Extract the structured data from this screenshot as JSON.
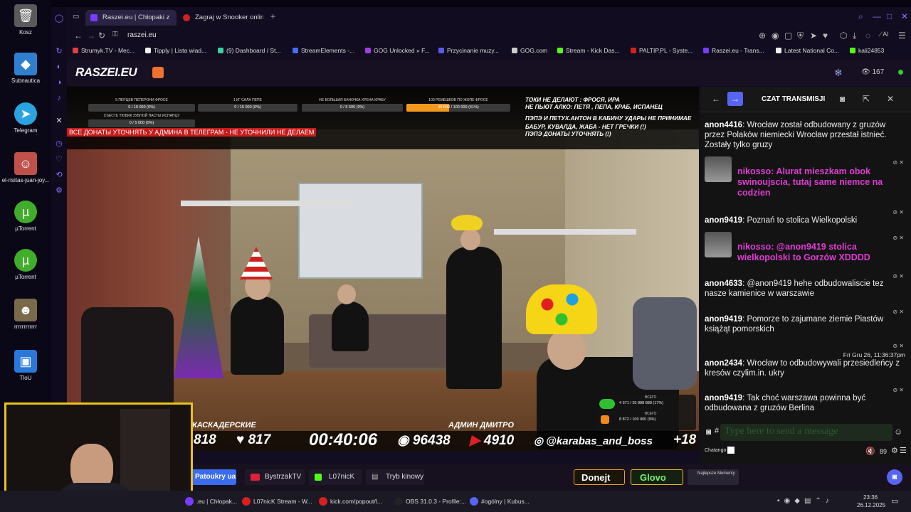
{
  "desktop": {
    "icons": [
      {
        "label": "Kosz",
        "icon": "trash-icon",
        "color": "#8a8a8a"
      },
      {
        "label": "Subnautica",
        "icon": "subnautica-icon",
        "color": "#2f7fd0"
      },
      {
        "label": "Telegram",
        "icon": "telegram-icon",
        "color": "#2aa3e0"
      },
      {
        "label": "el-risitas-juan-joy...",
        "icon": "image-file-icon",
        "color": "#c0504a"
      },
      {
        "label": "µTorrent",
        "icon": "utorrent-icon",
        "color": "#3fae2a"
      },
      {
        "label": "µTorrent",
        "icon": "utorrent-icon",
        "color": "#3fae2a"
      },
      {
        "label": "rrrrrrrrrrrr",
        "icon": "image-file-icon",
        "color": "#7a6a4a"
      },
      {
        "label": "TloU",
        "icon": "shortcut-icon",
        "color": "#2a78d8"
      }
    ]
  },
  "browser": {
    "tabs": [
      {
        "label": "Raszei.eu | Chłopaki z",
        "active": true,
        "favicon_color": "#7a3cff"
      },
      {
        "label": "Zagraj w Snooker online za",
        "active": false,
        "favicon_color": "#d02020"
      }
    ],
    "url": "raszei.eu",
    "bookmarks": [
      {
        "label": "Strumyk.TV - Mec...",
        "color": "#e04040"
      },
      {
        "label": "Tipply | Lista wiad...",
        "color": "#f0f0f0"
      },
      {
        "label": "(9) Dashboard / St...",
        "color": "#3ad0a0"
      },
      {
        "label": "StreamElements -...",
        "color": "#4a6cf0"
      },
      {
        "label": "GOG Unlocked » F...",
        "color": "#a040e0"
      },
      {
        "label": "Przycinanie muzy...",
        "color": "#5a5af0"
      },
      {
        "label": "GOG.com",
        "color": "#cccccc"
      },
      {
        "label": "Stream - Kick Das...",
        "color": "#53fc18"
      },
      {
        "label": "PALTIP.PL - Syste...",
        "color": "#d82020"
      },
      {
        "label": "Raszei.eu - Trans...",
        "color": "#7a3cff"
      },
      {
        "label": "Latest National Co...",
        "color": "#f0f0f0"
      },
      {
        "label": "kali24853",
        "color": "#53fc18"
      }
    ]
  },
  "site": {
    "logo": "RASZEI.EU",
    "viewers": "167",
    "overlay": {
      "goals": [
        {
          "label": "5 ПЕРЦЕВ ПЕПЕРОНИ ФРОСЕ",
          "value": "0 / 10 000 (0%)"
        },
        {
          "label": "1 КГ САЛА ПЕПЕ",
          "value": "0 / 15 000 (0%)"
        },
        {
          "label": "НЕ БОЛЬШАЯ БАНОЧКА ХРЕНА КРАБУ",
          "value": "0 / 5 500 (0%)"
        },
        {
          "label": "100 РЕМЕШКОВ ПО ЖОПЕ ФРОСЕ",
          "value": "40 600 / 100 000 (41%)",
          "progress": 0.41
        },
        {
          "label": "СЪЕСТЬ ТЮБИК ЗУБНОЙ ПАСТЫ ИСПАНЦУ",
          "value": "0 / 5 000 (0%)"
        }
      ],
      "right_text_1": "ТОКИ НЕ ДЕЛАЮТ : ФРОСЯ, ИРА",
      "right_text_2": "НЕ ПЬЮТ АЛКО: ПЕТЯ , ПЕПА, КРАБ, ИСПАНЕЦ",
      "right_text_3": "ПЭПЭ И ПЕТУХ.АНТОН В КАБИНУ УДАРЫ НЕ ПРИНИМАЕ",
      "right_text_4": "БАБУР, КУВАЛДА, ЖАБА - НЕТ ГРЕЧКИ (!)",
      "right_text_5": "ПЭПЭ ДОНАТЫ УТОЧНЯТЬ (!)",
      "red_note": "ВСЕ ДОНАТЫ УТОЧНЯТЬ У АДМИНА В ТЕЛЕГРАМ - НЕ УТОЧНИЛИ НЕ ДЕЛАЕМ",
      "name_left": "КАСКАДЕРСКИЕ",
      "name_right": "АДМИН ДМИТРО",
      "stats": {
        "left_num": "818",
        "likes": "817",
        "timer": "00:40:06",
        "views": "96438",
        "youtube": "4910",
        "instagram": "@karabas_and_boss",
        "plus": "+18"
      },
      "total_1_label": "ВСЕГО",
      "total_1": "4 371 / 25 888 888 (17%)",
      "total_2_label": "ВСЕГО",
      "total_2": "8 872 / 100 000 (9%)"
    },
    "chat": {
      "title": "CZAT TRANSMISJI",
      "messages": [
        {
          "user": "anon4416",
          "text": "Wrocław został odbudowany z gruzów przez Polaków niemiecki Wrocław przestał istnieć. Zostały tylko gruzy",
          "pink": false
        },
        {
          "user": "nikosso",
          "text": "Alurat mieszkam obok swinoujscia, tutaj same niemce na codzien",
          "pink": true
        },
        {
          "user": "anon9419",
          "text": "Poznań to stolica Wielkopolski",
          "pink": false
        },
        {
          "user": "nikosso",
          "text": "@anon9419 stolica wielkopolski to Gorzów XDDDD",
          "pink": true
        },
        {
          "user": "anon4633",
          "text": "@anon9419 hehe odbudowaliscie tez nasze kamienice w warszawie",
          "pink": false
        },
        {
          "user": "anon9419",
          "text": "Pomorze to zajumane ziemie Piastów książąt pomorskich",
          "pink": false
        },
        {
          "user": "anon2434",
          "text": "Wrocław to odbudowywali przesiedleńcy z kresów czylim.in. ukry",
          "pink": false,
          "timestamp": "Fri Gru 26, 11:36:37pm"
        },
        {
          "user": "anon9419",
          "text": "Tak choć warszawa powinna być odbudowana z gruzów Berlina",
          "pink": false
        }
      ],
      "input_placeholder": "Type here to send a message",
      "footer_label": "Chatango",
      "volume": "89"
    },
    "footer_buttons": [
      {
        "label": "Patoukry ua",
        "color": "#3a6cf0"
      },
      {
        "label": "BystrzakTV",
        "color": "#e0203a"
      },
      {
        "label": "L07nicK",
        "color": "#53fc18"
      },
      {
        "label": "Tryb kinowy",
        "color": "#bbbbbb"
      }
    ],
    "donate": "Donejt",
    "glovo": "Glovo",
    "best": "Najlepsze Momenty"
  },
  "taskbar": {
    "items": [
      {
        "label": ".eu | Chłopak...",
        "color": "#7a3cff"
      },
      {
        "label": "L07nicK Stream - W...",
        "color": "#d82020"
      },
      {
        "label": "kick.com/popout/l...",
        "color": "#d82020"
      },
      {
        "label": "OBS 31.0.3 - Profile:...",
        "color": "#222222"
      },
      {
        "label": "#ogólny | Kubus...",
        "color": "#5865f2"
      }
    ],
    "time": "23:36",
    "date": "26.12.2025"
  }
}
